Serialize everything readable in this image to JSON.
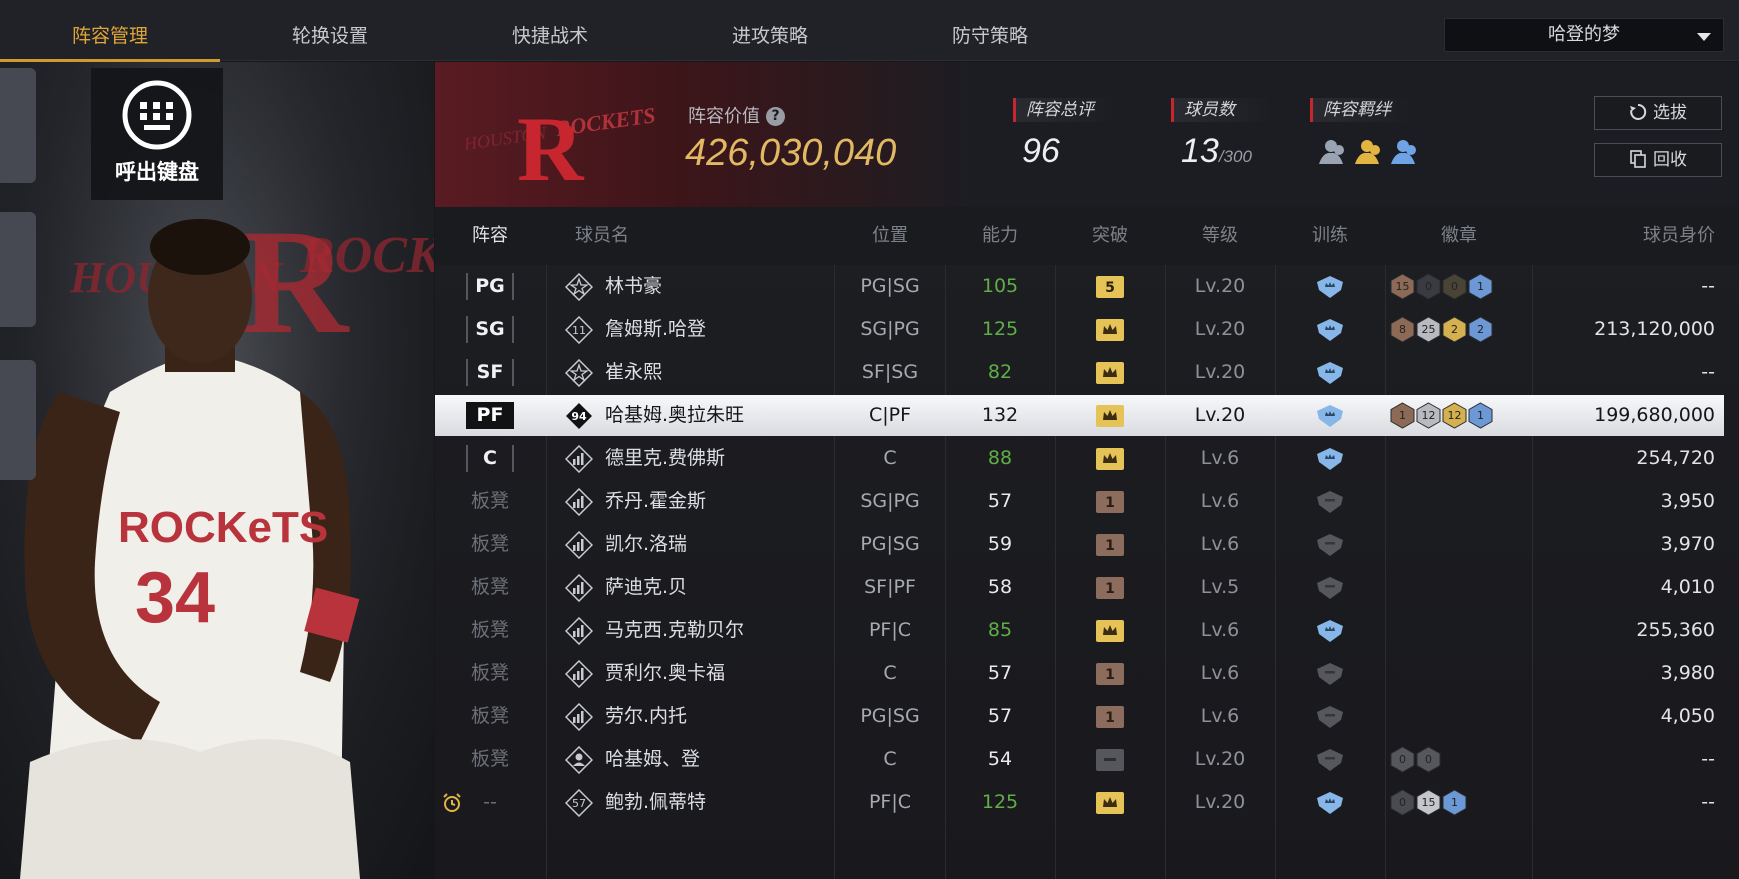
{
  "nav": {
    "tabs": [
      "阵容管理",
      "轮换设置",
      "快捷战术",
      "进攻策略",
      "防守策略"
    ],
    "active_index": 0,
    "team_name": "哈登的梦"
  },
  "overlay": {
    "keyboard_label": "呼出键盘"
  },
  "header": {
    "value_label": "阵容价值",
    "value": "426,030,040",
    "rating_title": "阵容总评",
    "rating": "96",
    "players_title": "球员数",
    "players_count": "13",
    "players_max": "/300",
    "bonds_title": "阵容羁绊",
    "draft_button": "选拔",
    "recycle_button": "回收",
    "logo_text": "HOUSTON ROCKETS"
  },
  "table": {
    "columns": [
      "阵容",
      "球员名",
      "位置",
      "能力",
      "突破",
      "等级",
      "训练",
      "徽章",
      "球员身价"
    ],
    "rows": [
      {
        "slot": "PG",
        "starter": true,
        "icon": "star-icon",
        "name": "林书豪",
        "pos": "PG|SG",
        "rating": "105",
        "rating_color": "green",
        "breakthrough": "5",
        "level": "Lv.20",
        "trained": true,
        "badges": [
          "15",
          "0",
          "0",
          "1"
        ],
        "price": "--"
      },
      {
        "slot": "SG",
        "starter": true,
        "icon": "number-11-icon",
        "name": "詹姆斯.哈登",
        "pos": "SG|PG",
        "rating": "125",
        "rating_color": "green",
        "breakthrough": "crown",
        "level": "Lv.20",
        "trained": true,
        "badges": [
          "8",
          "25",
          "2",
          "2"
        ],
        "price": "213,120,000"
      },
      {
        "slot": "SF",
        "starter": true,
        "icon": "star-icon",
        "name": "崔永熙",
        "pos": "SF|SG",
        "rating": "82",
        "rating_color": "green",
        "breakthrough": "crown",
        "level": "Lv.20",
        "trained": true,
        "badges": [],
        "price": "--"
      },
      {
        "slot": "PF",
        "starter": true,
        "selected": true,
        "icon": "number-94-icon",
        "name": "哈基姆.奥拉朱旺",
        "pos": "C|PF",
        "rating": "132",
        "rating_color": "dark",
        "breakthrough": "crown",
        "level": "Lv.20",
        "trained": true,
        "badges": [
          "1",
          "12",
          "12",
          "1"
        ],
        "price": "199,680,000"
      },
      {
        "slot": "C",
        "starter": true,
        "icon": "bars-icon",
        "name": "德里克.费佛斯",
        "pos": "C",
        "rating": "88",
        "rating_color": "green",
        "breakthrough": "crown",
        "level": "Lv.6",
        "trained": true,
        "badges": [],
        "price": "254,720"
      },
      {
        "slot": "板凳",
        "starter": false,
        "icon": "bars-icon",
        "name": "乔丹.霍金斯",
        "pos": "SG|PG",
        "rating": "57",
        "rating_color": "white",
        "breakthrough": "1",
        "level": "Lv.6",
        "trained": false,
        "badges": [],
        "price": "3,950"
      },
      {
        "slot": "板凳",
        "starter": false,
        "icon": "bars-icon",
        "name": "凯尔.洛瑞",
        "pos": "PG|SG",
        "rating": "59",
        "rating_color": "white",
        "breakthrough": "1",
        "level": "Lv.6",
        "trained": false,
        "badges": [],
        "price": "3,970"
      },
      {
        "slot": "板凳",
        "starter": false,
        "icon": "bars-icon",
        "name": "萨迪克.贝",
        "pos": "SF|PF",
        "rating": "58",
        "rating_color": "white",
        "breakthrough": "1",
        "level": "Lv.5",
        "trained": false,
        "badges": [],
        "price": "4,010"
      },
      {
        "slot": "板凳",
        "starter": false,
        "icon": "bars-icon",
        "name": "马克西.克勒贝尔",
        "pos": "PF|C",
        "rating": "85",
        "rating_color": "green",
        "breakthrough": "crown",
        "level": "Lv.6",
        "trained": true,
        "badges": [],
        "price": "255,360"
      },
      {
        "slot": "板凳",
        "starter": false,
        "icon": "bars-icon",
        "name": "贾利尔.奥卡福",
        "pos": "C",
        "rating": "57",
        "rating_color": "white",
        "breakthrough": "1",
        "level": "Lv.6",
        "trained": false,
        "badges": [],
        "price": "3,980"
      },
      {
        "slot": "板凳",
        "starter": false,
        "icon": "bars-icon",
        "name": "劳尔.内托",
        "pos": "PG|SG",
        "rating": "57",
        "rating_color": "white",
        "breakthrough": "1",
        "level": "Lv.6",
        "trained": false,
        "badges": [],
        "price": "4,050"
      },
      {
        "slot": "板凳",
        "starter": false,
        "icon": "person-icon",
        "name": "哈基姆、登",
        "pos": "C",
        "rating": "54",
        "rating_color": "white",
        "breakthrough": "none",
        "level": "Lv.20",
        "trained": false,
        "badges": [
          "0",
          "0"
        ],
        "price": "--"
      },
      {
        "slot": "--",
        "starter": false,
        "alarm": true,
        "icon": "number-57-icon",
        "name": "鲍勃.佩蒂特",
        "pos": "PF|C",
        "rating": "125",
        "rating_color": "green",
        "breakthrough": "crown",
        "level": "Lv.20",
        "trained": true,
        "badges": [
          "0",
          "15",
          "1"
        ],
        "price": "--"
      }
    ]
  },
  "colors": {
    "accent": "#e0a637",
    "green": "#5fae47",
    "rocket_red": "#c8262e"
  }
}
